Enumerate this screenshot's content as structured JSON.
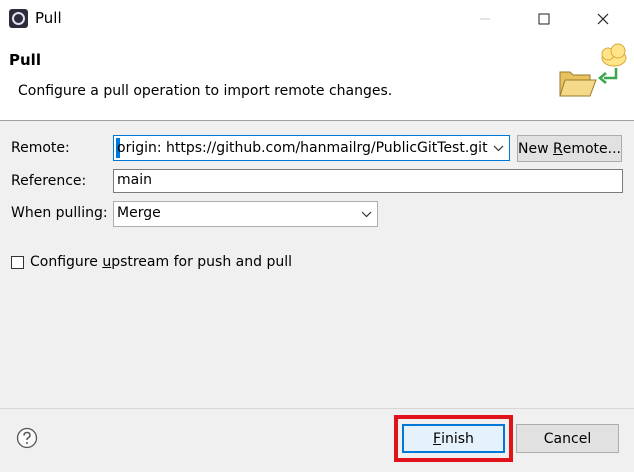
{
  "window": {
    "title": "Pull",
    "controls": {
      "minimize_icon": "minimize-icon",
      "maximize_icon": "maximize-icon",
      "close_icon": "close-icon"
    }
  },
  "header": {
    "title": "Pull",
    "description": "Configure a pull operation to import remote changes.",
    "graphic_icon": "folder-cloud-pull-icon"
  },
  "form": {
    "remote_label": "Remote:",
    "remote_value": "origin: https://github.com/hanmailrg/PublicGitTest.git",
    "new_remote_prefix": "New ",
    "new_remote_accel": "R",
    "new_remote_suffix": "emote...",
    "reference_label": "Reference:",
    "reference_value": "main",
    "when_pulling_label": "When pulling:",
    "when_pulling_value": "Merge",
    "upstream_checked": false,
    "upstream_prefix": "Configure ",
    "upstream_accel": "u",
    "upstream_suffix": "pstream for push and pull"
  },
  "footer": {
    "help_icon": "help-icon",
    "finish_accel": "F",
    "finish_suffix": "inish",
    "cancel_label": "Cancel"
  },
  "colors": {
    "accent": "#0078d7",
    "highlight_border": "#e0131a"
  }
}
